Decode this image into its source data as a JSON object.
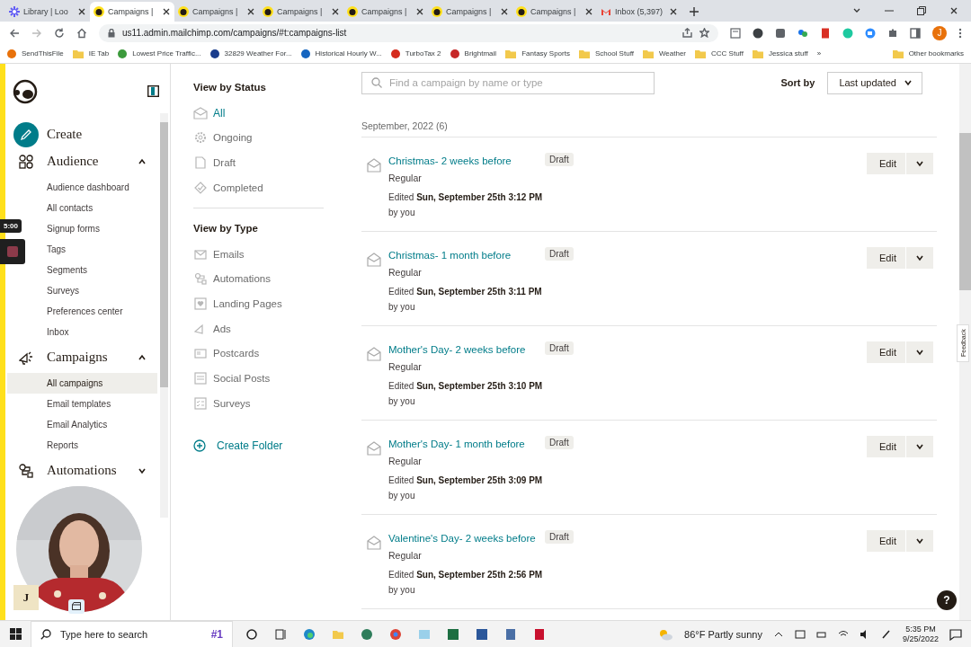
{
  "browser": {
    "tabs": [
      {
        "kind": "loom",
        "title": "Library | Loo",
        "selected": false
      },
      {
        "kind": "mailchimp",
        "title": "Campaigns |",
        "selected": true
      },
      {
        "kind": "mailchimp",
        "title": "Campaigns |",
        "selected": false
      },
      {
        "kind": "mailchimp",
        "title": "Campaigns |",
        "selected": false
      },
      {
        "kind": "mailchimp",
        "title": "Campaigns |",
        "selected": false
      },
      {
        "kind": "mailchimp",
        "title": "Campaigns |",
        "selected": false
      },
      {
        "kind": "mailchimp",
        "title": "Campaigns |",
        "selected": false
      },
      {
        "kind": "gmail",
        "title": "Inbox (5,397)",
        "selected": false
      }
    ],
    "address": "us11.admin.mailchimp.com/campaigns/#t:campaigns-list",
    "profile_initial": "J",
    "bookmarks": [
      {
        "kind": "site",
        "label": "SendThisFile",
        "color": "#e8710a"
      },
      {
        "kind": "folder",
        "label": "IE Tab"
      },
      {
        "kind": "site",
        "label": "Lowest Price Traffic...",
        "color": "#3c9a3c"
      },
      {
        "kind": "site",
        "label": "32829 Weather For...",
        "color": "#1a3c8c"
      },
      {
        "kind": "site",
        "label": "Historical Hourly W...",
        "color": "#1565c0"
      },
      {
        "kind": "site",
        "label": "TurboTax 2",
        "color": "#d52b1e"
      },
      {
        "kind": "site",
        "label": "Brightmail",
        "color": "#c62828"
      },
      {
        "kind": "folder",
        "label": "Fantasy Sports"
      },
      {
        "kind": "folder",
        "label": "School Stuff"
      },
      {
        "kind": "folder",
        "label": "Weather"
      },
      {
        "kind": "folder",
        "label": "CCC Stuff"
      },
      {
        "kind": "folder",
        "label": "Jessica stuff"
      }
    ],
    "bookmarks_overflow": "»",
    "other_bookmarks": "Other bookmarks"
  },
  "sidebar": {
    "nav": [
      {
        "kind": "create",
        "label": "Create"
      },
      {
        "kind": "section",
        "label": "Audience",
        "expanded": true,
        "children": [
          {
            "label": "Audience dashboard",
            "selected": false
          },
          {
            "label": "All contacts",
            "selected": false
          },
          {
            "label": "Signup forms",
            "selected": false
          },
          {
            "label": "Tags",
            "selected": false
          },
          {
            "label": "Segments",
            "selected": false
          },
          {
            "label": "Surveys",
            "selected": false
          },
          {
            "label": "Preferences center",
            "selected": false
          },
          {
            "label": "Inbox",
            "selected": false
          }
        ]
      },
      {
        "kind": "section",
        "label": "Campaigns",
        "expanded": true,
        "children": [
          {
            "label": "All campaigns",
            "selected": true
          },
          {
            "label": "Email templates",
            "selected": false
          },
          {
            "label": "Email Analytics",
            "selected": false
          },
          {
            "label": "Reports",
            "selected": false
          }
        ]
      },
      {
        "kind": "section",
        "label": "Automations",
        "expanded": false
      }
    ],
    "user_initial": "J"
  },
  "recorder": {
    "timer": "5:00"
  },
  "filters": {
    "status_heading": "View by Status",
    "status": [
      {
        "label": "All",
        "selected": true
      },
      {
        "label": "Ongoing",
        "selected": false
      },
      {
        "label": "Draft",
        "selected": false
      },
      {
        "label": "Completed",
        "selected": false
      }
    ],
    "type_heading": "View by Type",
    "types": [
      "Emails",
      "Automations",
      "Landing Pages",
      "Ads",
      "Postcards",
      "Social Posts",
      "Surveys"
    ],
    "create_folder": "Create Folder"
  },
  "list": {
    "search": {
      "placeholder": "Find a campaign by name or type"
    },
    "sort_label": "Sort by",
    "sort_value": "Last updated",
    "group": "September, 2022 (6)",
    "campaigns": [
      {
        "title": "Christmas- 2 weeks before",
        "type": "Regular",
        "edited": "Edited **Sun, September 25th 3:12 PM** by you",
        "status": "Draft",
        "action": "Edit"
      },
      {
        "title": "Christmas- 1 month before",
        "type": "Regular",
        "edited": "Edited **Sun, September 25th 3:11 PM** by you",
        "status": "Draft",
        "action": "Edit"
      },
      {
        "title": "Mother's Day- 2 weeks before",
        "type": "Regular",
        "edited": "Edited **Sun, September 25th 3:10 PM** by you",
        "status": "Draft",
        "action": "Edit"
      },
      {
        "title": "Mother's Day- 1 month before",
        "type": "Regular",
        "edited": "Edited **Sun, September 25th 3:09 PM** by you",
        "status": "Draft",
        "action": "Edit"
      },
      {
        "title": "Valentine's Day- 2 weeks before",
        "type": "Regular",
        "edited": "Edited **Sun, September 25th 2:56 PM** by you",
        "status": "Draft",
        "action": "Edit"
      }
    ],
    "feedback": "Feedback",
    "help": "?"
  },
  "taskbar": {
    "search_placeholder": "Type here to search",
    "search_highlight": "#1",
    "weather": "86°F Partly sunny",
    "time": "5:35 PM",
    "date": "9/25/2022"
  }
}
